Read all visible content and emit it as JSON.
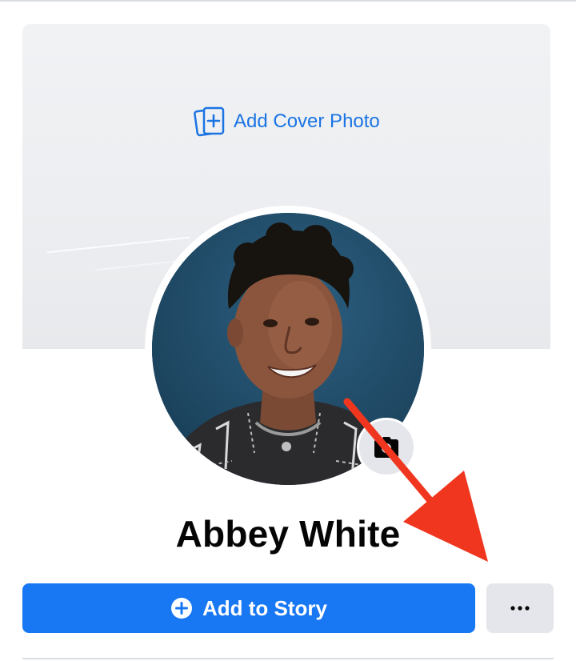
{
  "cover": {
    "add_cover_label": "Add Cover Photo"
  },
  "profile": {
    "name": "Abbey White"
  },
  "actions": {
    "add_to_story_label": "Add to Story",
    "more_label": "…"
  },
  "icons": {
    "add_cover": "add-photo-icon",
    "camera": "camera-icon",
    "plus": "plus-circle-icon",
    "more": "more-dots-icon"
  },
  "colors": {
    "brand_blue": "#1877f2",
    "link_blue": "#1b74e4",
    "button_gray": "#e4e6eb",
    "annotation_red": "#f0361e"
  }
}
